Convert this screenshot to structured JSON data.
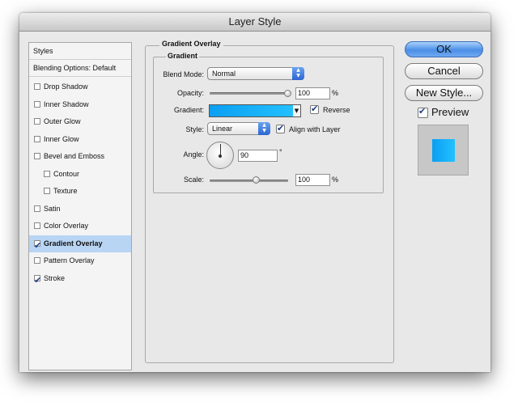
{
  "window": {
    "title": "Layer Style"
  },
  "styles_list": {
    "header": "Styles",
    "blending": "Blending Options: Default",
    "items": [
      {
        "label": "Drop Shadow",
        "checked": false,
        "selected": false,
        "indent": false
      },
      {
        "label": "Inner Shadow",
        "checked": false,
        "selected": false,
        "indent": false
      },
      {
        "label": "Outer Glow",
        "checked": false,
        "selected": false,
        "indent": false
      },
      {
        "label": "Inner Glow",
        "checked": false,
        "selected": false,
        "indent": false
      },
      {
        "label": "Bevel and Emboss",
        "checked": false,
        "selected": false,
        "indent": false
      },
      {
        "label": "Contour",
        "checked": false,
        "selected": false,
        "indent": true
      },
      {
        "label": "Texture",
        "checked": false,
        "selected": false,
        "indent": true
      },
      {
        "label": "Satin",
        "checked": false,
        "selected": false,
        "indent": false
      },
      {
        "label": "Color Overlay",
        "checked": false,
        "selected": false,
        "indent": false
      },
      {
        "label": "Gradient Overlay",
        "checked": true,
        "selected": true,
        "indent": false
      },
      {
        "label": "Pattern Overlay",
        "checked": false,
        "selected": false,
        "indent": false
      },
      {
        "label": "Stroke",
        "checked": true,
        "selected": false,
        "indent": false
      }
    ]
  },
  "gradient_overlay": {
    "section_title": "Gradient Overlay",
    "group_title": "Gradient",
    "blend_mode_label": "Blend Mode:",
    "blend_mode_value": "Normal",
    "opacity_label": "Opacity:",
    "opacity_value": "100",
    "opacity_unit": "%",
    "opacity_level": 1.0,
    "gradient_label": "Gradient:",
    "gradient_colors": [
      "#0a9ff2",
      "#24c0ff"
    ],
    "reverse_label": "Reverse",
    "reverse_checked": true,
    "style_label": "Style:",
    "style_value": "Linear",
    "align_label": "Align with Layer",
    "align_checked": true,
    "angle_label": "Angle:",
    "angle_value": "90",
    "angle_unit": "°",
    "scale_label": "Scale:",
    "scale_value": "100",
    "scale_unit": "%",
    "scale_level": 0.6
  },
  "buttons": {
    "ok": "OK",
    "cancel": "Cancel",
    "new_style": "New Style...",
    "preview_label": "Preview",
    "preview_checked": true
  },
  "icons": {
    "popup_arrows": "up-down-arrows-icon",
    "gradient_dropdown": "triangle-down-icon",
    "checkmark": "checkmark-icon",
    "angle_dial": "angle-dial-icon"
  },
  "colors": {
    "selection": "#b8d5f4",
    "accent_blue": "#4b8fe6",
    "preview_fill": "#1cb5fb"
  }
}
